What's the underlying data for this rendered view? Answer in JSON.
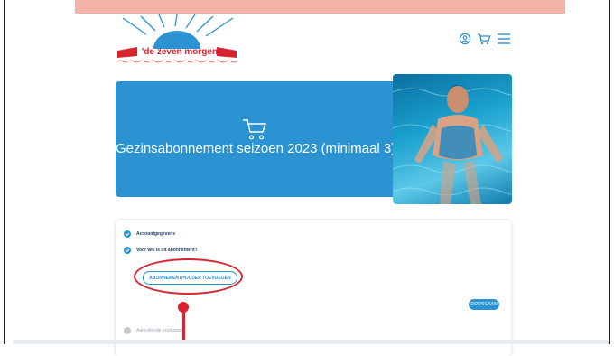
{
  "brand": {
    "logo_text": "'de zeven morgen'",
    "sun_color": "#2b93d1",
    "accent_red": "#d9232e"
  },
  "header": {
    "icons": [
      "user-icon",
      "cart-icon",
      "menu-icon"
    ]
  },
  "hero": {
    "icon": "cart-icon",
    "title": "Gezinsabonnement seizoen 2023 (minimaal 3)",
    "background": "#2b93d1"
  },
  "steps": [
    {
      "label": "Accountgegevens",
      "status": "done"
    },
    {
      "label": "Voor wie is dit abonnement?",
      "status": "active"
    },
    {
      "label": "Aanvullende producten",
      "status": "pending"
    }
  ],
  "actions": {
    "add_holder_label": "ABONNEMENTHOUDER TOEVOEGEN",
    "next_label": "DOORGAAN"
  }
}
